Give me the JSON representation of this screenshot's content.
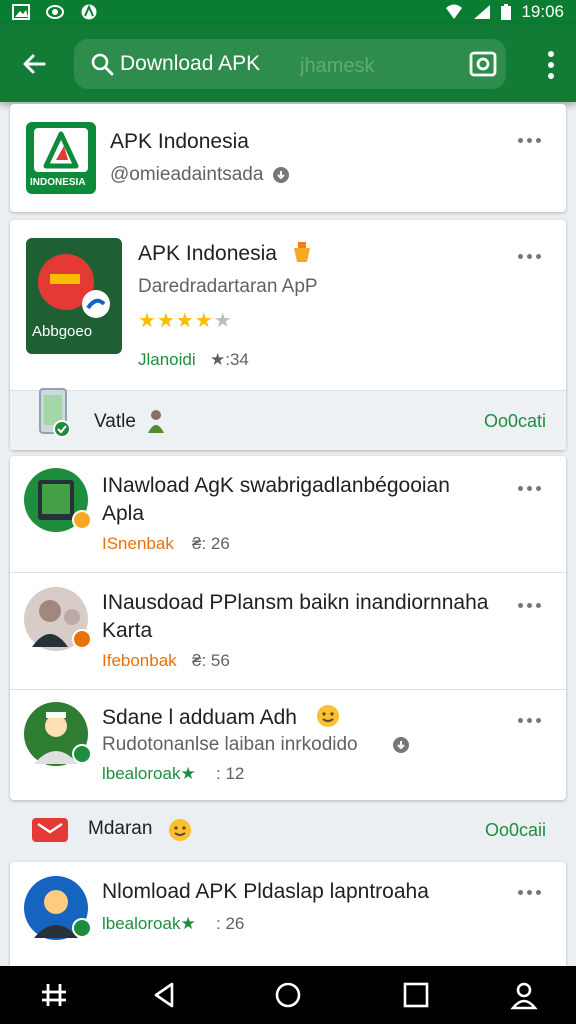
{
  "status_bar": {
    "time": "19:06"
  },
  "app_bar": {
    "search_text": "Download APK",
    "search_ghost": "jhamesk"
  },
  "cards": {
    "top": {
      "title": "APK Indonesia",
      "handle": "@omieadaintsada",
      "icon_label": "INDONESIA"
    },
    "featured": {
      "title": "APK Indonesia",
      "subtitle": "Daredradartaran ApP",
      "rating_stars": 4,
      "meta_name": "Jlanoidi",
      "meta_count": "★:34",
      "icon_label": "Abbgoeo"
    },
    "section1": {
      "label": "Vatle",
      "action": "Oo0cati"
    },
    "list1": [
      {
        "title_line1": "INawload AgK swabrigadlanbégooian",
        "title_line2": "Apla",
        "meta_name": "ISnenbak",
        "meta_count": "₴: 26"
      },
      {
        "title_line1": "INausdoad PPlansm baikn inandiornnaha",
        "title_line2": "Karta",
        "meta_name": "Ifebonbak",
        "meta_count": "₴: 56"
      },
      {
        "title_line1": "Sdane l adduam Adh",
        "subtitle": "Rudotonanlse laiban inrkodido",
        "meta_name": "lbealoroak★",
        "meta_count": ": 12"
      }
    ],
    "section2": {
      "label": "Mdaran",
      "action": "Oo0caii"
    },
    "list2": [
      {
        "title_line1": "Nlomload APK Pldaslap lapntroaha",
        "meta_name": "lbealoroak★",
        "meta_count": ": 26"
      }
    ]
  },
  "colors": {
    "brand_green": "#127c36",
    "accent_green": "#1e8e3e",
    "accent_orange": "#e8710a",
    "star": "#fbbc04"
  },
  "icons": [
    "signal-icon",
    "wifi-icon",
    "battery-icon",
    "back-arrow-icon",
    "search-icon",
    "camera-icon",
    "more-vert-icon",
    "more-horiz-icon",
    "verified-icon",
    "star-icon",
    "nav-recent-icon",
    "nav-back-icon",
    "nav-home-icon",
    "nav-overview-icon",
    "nav-user-icon"
  ]
}
